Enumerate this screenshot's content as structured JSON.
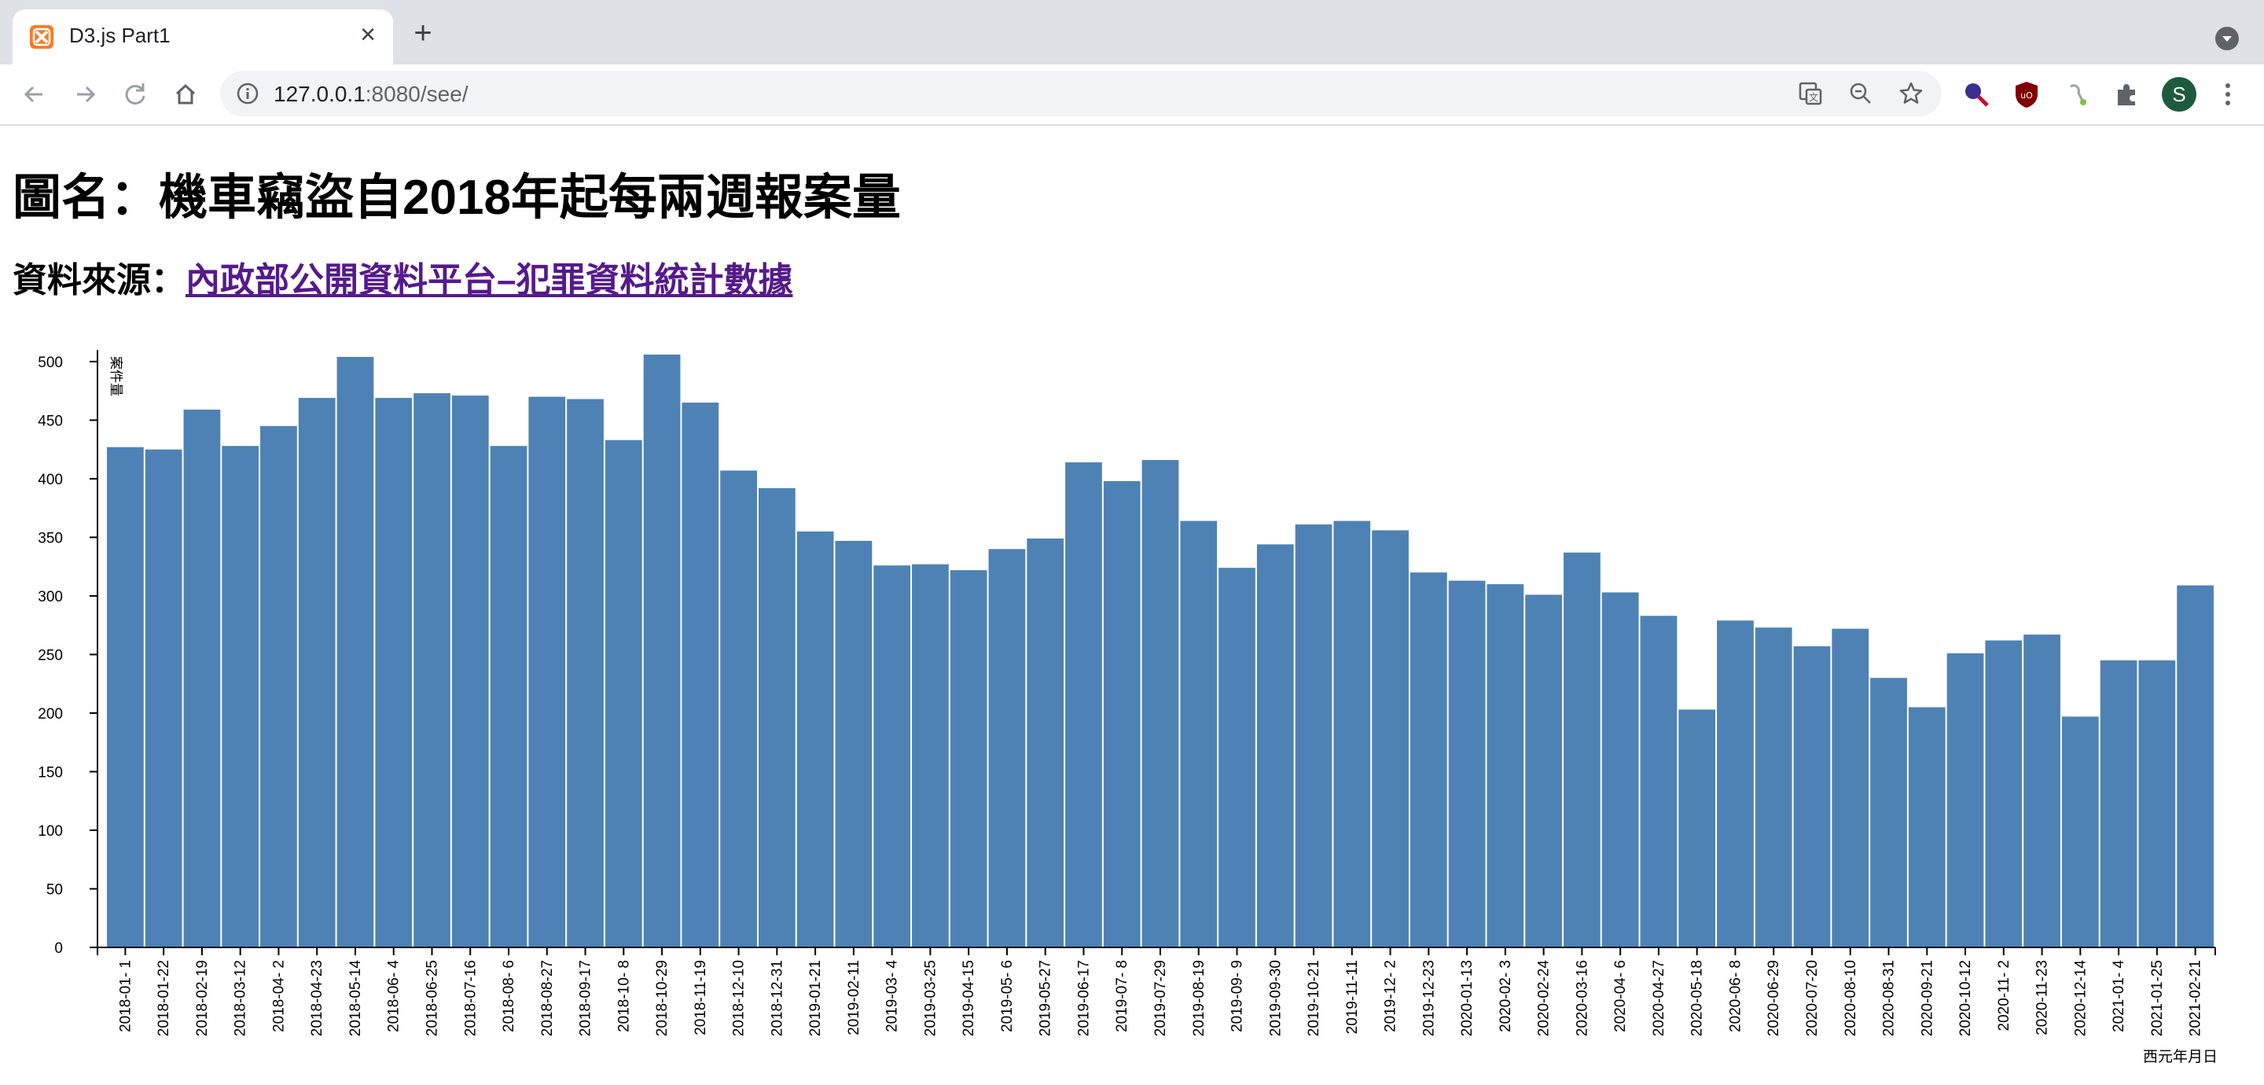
{
  "browser": {
    "tab_title": "D3.js Part1",
    "url_host": "127.0.0.1",
    "url_rest": ":8080/see/",
    "avatar_letter": "S"
  },
  "page": {
    "title": "圖名：機車竊盜自2018年起每兩週報案量",
    "source_label": "資料來源：",
    "source_link": "內政部公開資料平台–犯罪資料統計數據"
  },
  "chart_data": {
    "type": "bar",
    "xlabel": "西元年月日",
    "ylabel": "案件量",
    "ylim": [
      0,
      510
    ],
    "yticks": [
      0,
      50,
      100,
      150,
      200,
      250,
      300,
      350,
      400,
      450,
      500
    ],
    "bar_color": "#4e82b4",
    "categories": [
      "2018-01- 1",
      "2018-01-22",
      "2018-02-19",
      "2018-03-12",
      "2018-04- 2",
      "2018-04-23",
      "2018-05-14",
      "2018-06- 4",
      "2018-06-25",
      "2018-07-16",
      "2018-08- 6",
      "2018-08-27",
      "2018-09-17",
      "2018-10- 8",
      "2018-10-29",
      "2018-11-19",
      "2018-12-10",
      "2018-12-31",
      "2019-01-21",
      "2019-02-11",
      "2019-03- 4",
      "2019-03-25",
      "2019-04-15",
      "2019-05- 6",
      "2019-05-27",
      "2019-06-17",
      "2019-07- 8",
      "2019-07-29",
      "2019-08-19",
      "2019-09- 9",
      "2019-09-30",
      "2019-10-21",
      "2019-11-11",
      "2019-12- 2",
      "2019-12-23",
      "2020-01-13",
      "2020-02- 3",
      "2020-02-24",
      "2020-03-16",
      "2020-04- 6",
      "2020-04-27",
      "2020-05-18",
      "2020-06- 8",
      "2020-06-29",
      "2020-07-20",
      "2020-08-10",
      "2020-08-31",
      "2020-09-21",
      "2020-10-12",
      "2020-11- 2",
      "2020-11-23",
      "2020-12-14",
      "2021-01- 4",
      "2021-01-25",
      "2021-02-21"
    ],
    "values": [
      427,
      425,
      459,
      428,
      445,
      469,
      504,
      469,
      473,
      471,
      428,
      470,
      468,
      433,
      506,
      465,
      407,
      392,
      355,
      347,
      326,
      327,
      322,
      340,
      349,
      414,
      398,
      416,
      364,
      324,
      344,
      361,
      364,
      356,
      320,
      313,
      310,
      301,
      337,
      303,
      283,
      203,
      279,
      273,
      257,
      272,
      230,
      205,
      251,
      262,
      267,
      197,
      245,
      245,
      309
    ]
  }
}
